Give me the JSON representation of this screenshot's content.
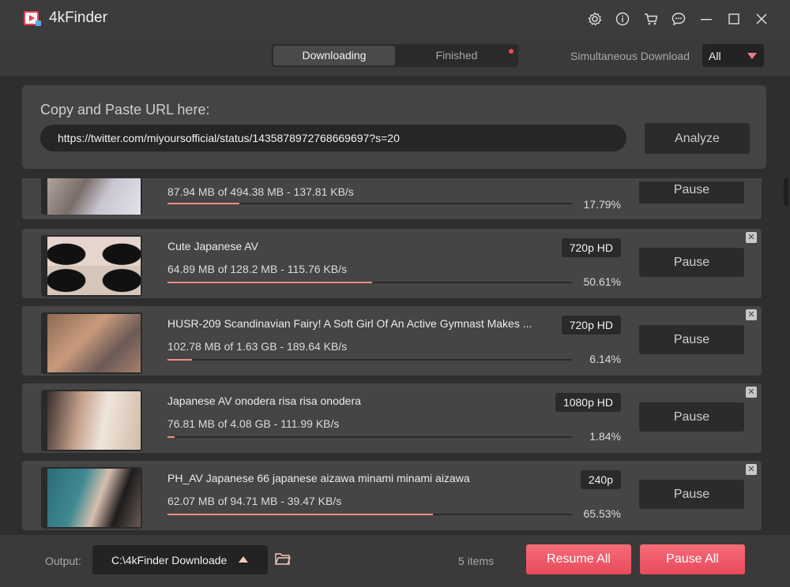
{
  "app": {
    "title": "4kFinder"
  },
  "tabs": {
    "downloading": "Downloading",
    "finished": "Finished"
  },
  "simultaneous": {
    "label": "Simultaneous Download",
    "value": "All"
  },
  "url_panel": {
    "label": "Copy and Paste URL here:",
    "value": "https://twitter.com/miyoursofficial/status/1435878972768669697?s=20",
    "analyze": "Analyze"
  },
  "items": [
    {
      "title": "",
      "stats": "87.94 MB of 494.38 MB - 137.81 KB/s",
      "percent": "17.79%",
      "progress": 0.1779,
      "quality": "",
      "pause": "Pause"
    },
    {
      "title": "Cute Japanese AV",
      "stats": "64.89 MB of 128.2 MB - 115.76 KB/s",
      "percent": "50.61%",
      "progress": 0.5061,
      "quality": "720p HD",
      "pause": "Pause"
    },
    {
      "title": "HUSR-209 Scandinavian Fairy! A Soft Girl Of An Active Gymnast Makes ...",
      "stats": "102.78 MB of 1.63 GB - 189.64 KB/s",
      "percent": "6.14%",
      "progress": 0.0614,
      "quality": "720p HD",
      "pause": "Pause"
    },
    {
      "title": "Japanese AV onodera risa risa onodera",
      "stats": "76.81 MB of 4.08 GB - 111.99 KB/s",
      "percent": "1.84%",
      "progress": 0.0184,
      "quality": "1080p HD",
      "pause": "Pause"
    },
    {
      "title": "PH_AV Japanese 66 japanese aizawa minami minami aizawa",
      "stats": "62.07 MB of 94.71 MB - 39.47 KB/s",
      "percent": "65.53%",
      "progress": 0.6553,
      "quality": "240p",
      "pause": "Pause"
    }
  ],
  "footer": {
    "output_label": "Output:",
    "output_path": "C:\\4kFinder Downloade",
    "items_count": "5 items",
    "resume_all": "Resume All",
    "pause_all": "Pause All"
  },
  "colors": {
    "accent": "#f05a6a",
    "progress": "#f08d84"
  }
}
